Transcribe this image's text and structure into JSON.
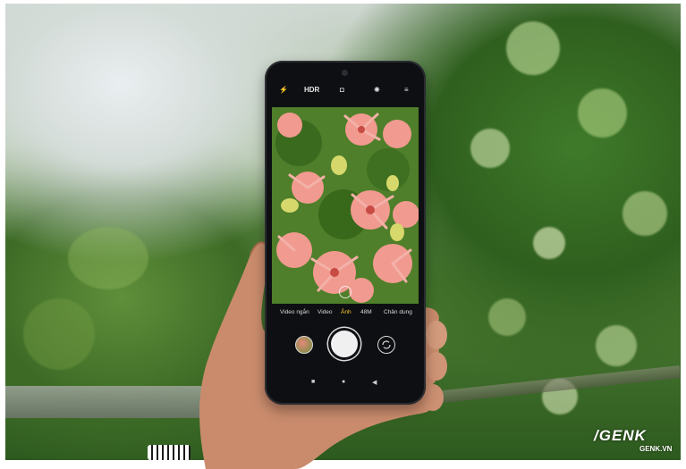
{
  "photo": {
    "description_colors": {
      "left_background": "#d4dcd8",
      "right_foliage": "#2f5f1e",
      "phone_body": "#0e0f12",
      "flower_pink": "#f08a84",
      "mode_highlight": "#ffcc33"
    }
  },
  "camera_app": {
    "topbar": {
      "flash_icon": "flash-auto-icon",
      "hdr_label": "HDR",
      "lens_icon": "lens-icon",
      "settings_icon": "settings-icon",
      "menu_icon": "menu-icon"
    },
    "modes": [
      "Video ngắn",
      "Video",
      "Ảnh",
      "48M",
      "Chân dung"
    ],
    "active_mode": "Ảnh",
    "nav": {
      "recent": "■",
      "home": "●",
      "back": "◀"
    }
  },
  "watermark": {
    "brand": "/GENK",
    "site": "GENK.VN"
  }
}
